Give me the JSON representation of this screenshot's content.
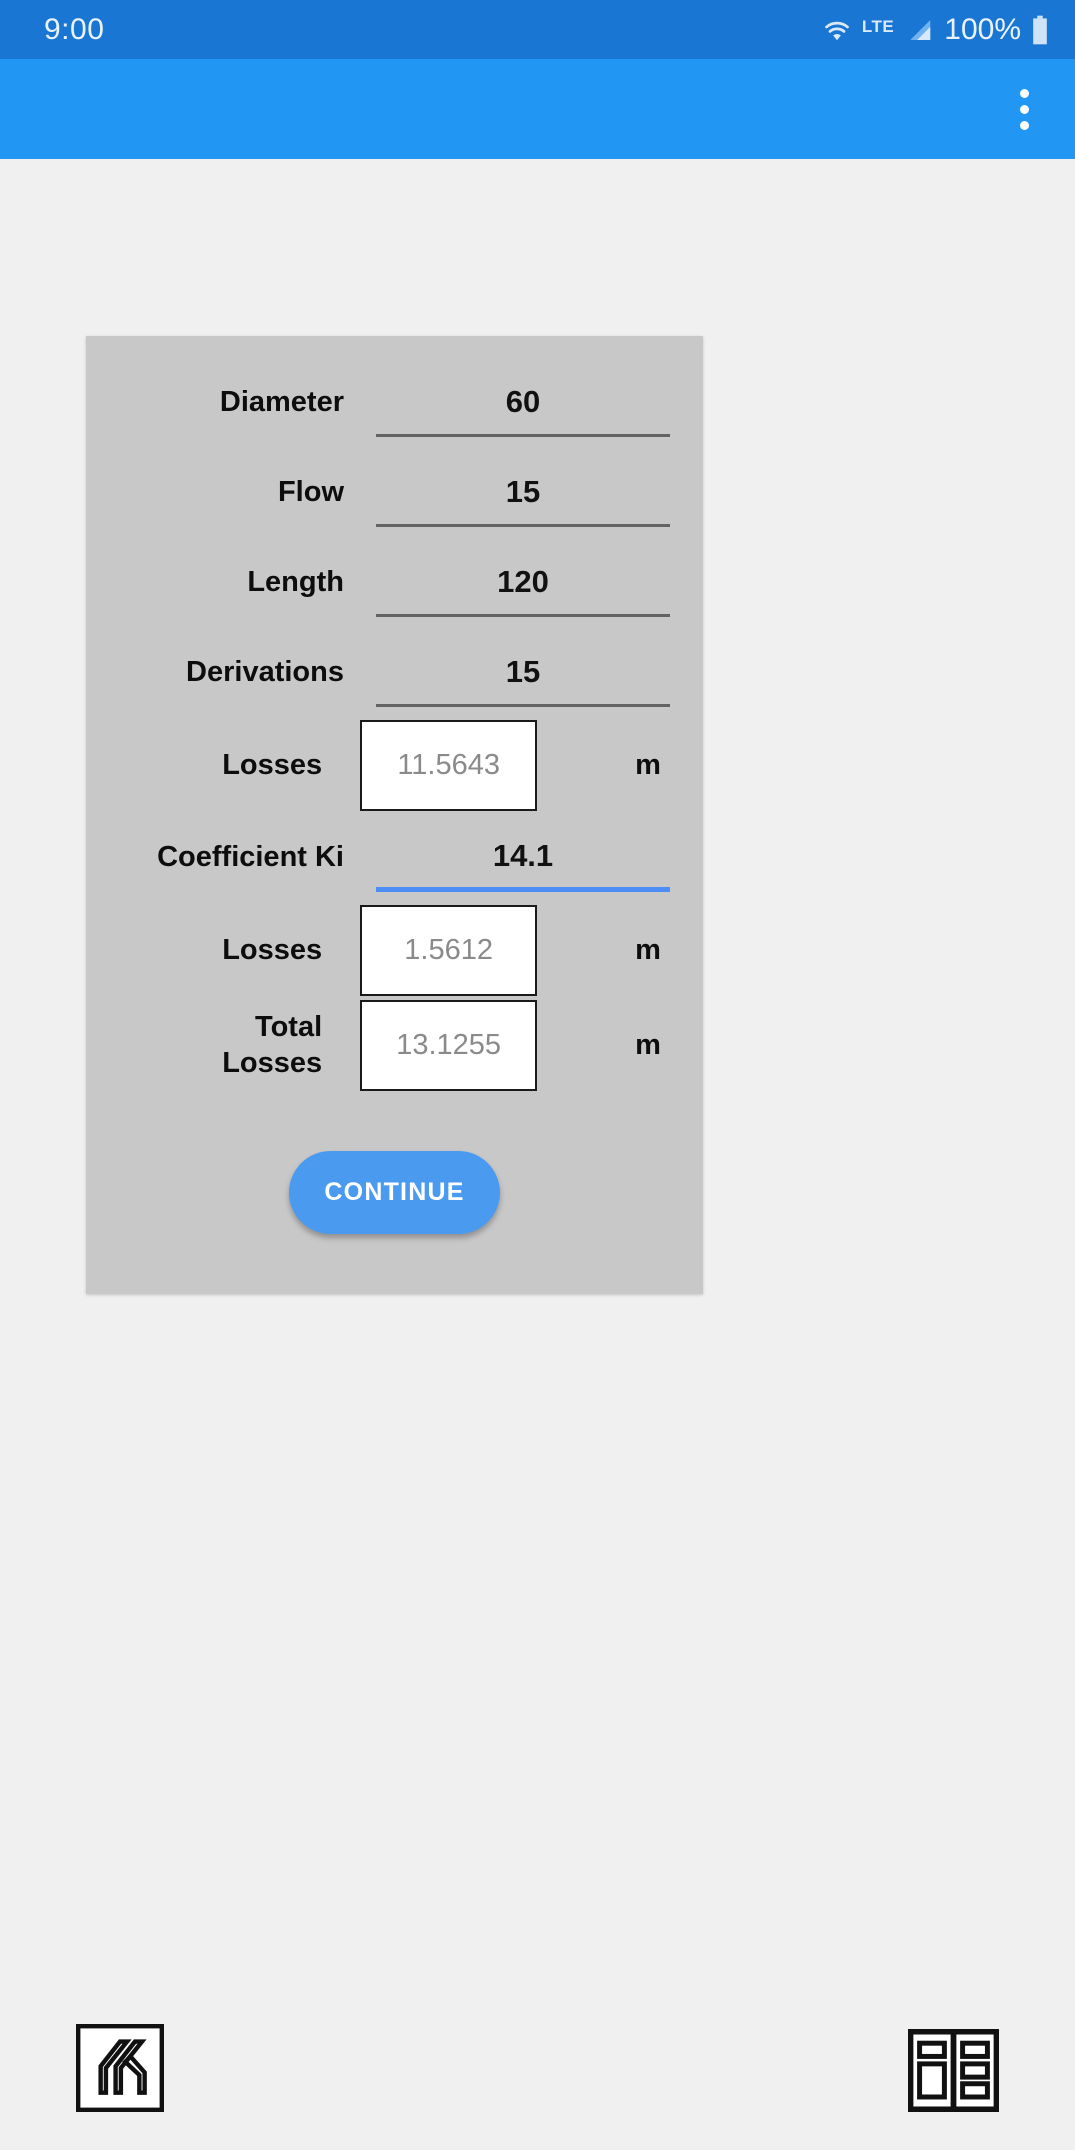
{
  "status_bar": {
    "clock": "9:00",
    "network_label": "LTE",
    "battery_percent": "100%",
    "icons": {
      "wifi": "wifi-icon",
      "signal": "signal-icon",
      "battery": "battery-icon"
    },
    "background_color": "#1976d2"
  },
  "app_bar": {
    "title": "",
    "overflow_menu": "more-options-icon",
    "background_color": "#2196f3"
  },
  "form": {
    "background_color": "#c8c8c8",
    "accent_color": "#4c8df6",
    "rows": [
      {
        "label": "Diameter",
        "value": "60",
        "type": "input",
        "unit": "",
        "focused": false
      },
      {
        "label": "Flow",
        "value": "15",
        "type": "input",
        "unit": "",
        "focused": false
      },
      {
        "label": "Length",
        "value": "120",
        "type": "input",
        "unit": "",
        "focused": false
      },
      {
        "label": "Derivations",
        "value": "15",
        "type": "input",
        "unit": "",
        "focused": false
      },
      {
        "label": "Losses",
        "value": "11.5643",
        "type": "output",
        "unit": "m",
        "focused": false
      },
      {
        "label": "Coefficient Ki",
        "value": "14.1",
        "type": "input",
        "unit": "",
        "focused": true
      },
      {
        "label": "Losses",
        "value": "1.5612",
        "type": "output",
        "unit": "m",
        "focused": false
      },
      {
        "label": "Total\nLosses",
        "value": "13.1255",
        "type": "output",
        "unit": "m",
        "focused": false
      }
    ],
    "continue_label": "CONTINUE"
  },
  "footer": {
    "logo_left": "building-columns-logo-icon",
    "logo_right": "panels-layout-logo-icon"
  }
}
